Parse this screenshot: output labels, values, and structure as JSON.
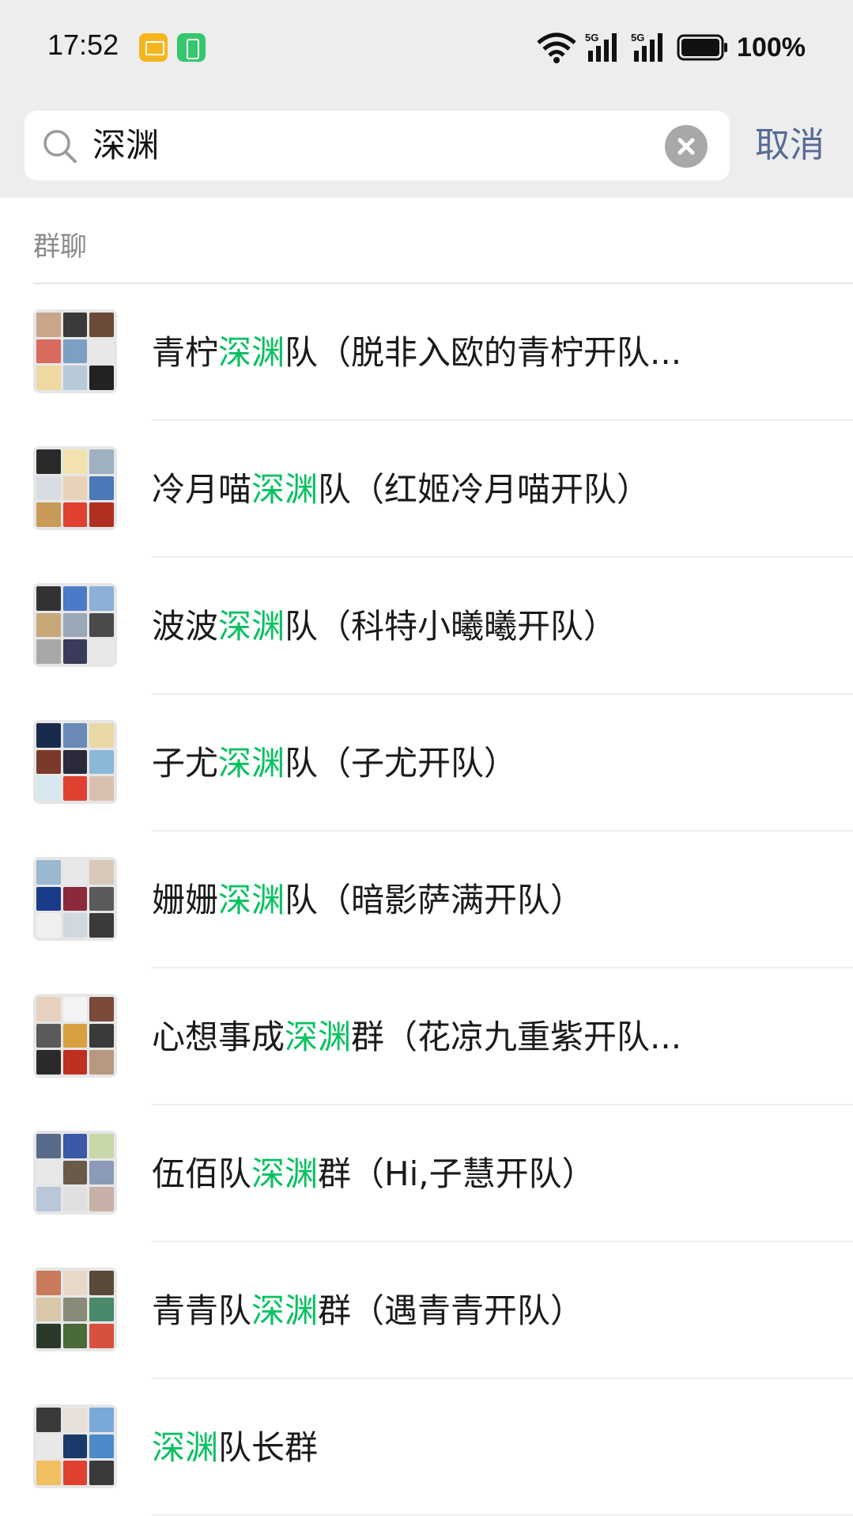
{
  "status_bar": {
    "time": "17:52",
    "battery_percent": "100%",
    "notification_icons": [
      "mail-icon",
      "battery-saver-icon"
    ],
    "system_icons": [
      "wifi-icon",
      "5g-signal-icon",
      "5g-signal-icon",
      "battery-icon"
    ],
    "network_label": "5G"
  },
  "search": {
    "query": "深渊",
    "cancel_label": "取消"
  },
  "section": {
    "title": "群聊"
  },
  "results": [
    {
      "pre": "青柠",
      "hl": "深渊",
      "post": "队（脱非入欧的青柠开队..."
    },
    {
      "pre": "冷月喵",
      "hl": "深渊",
      "post": "队（红姬冷月喵开队）"
    },
    {
      "pre": "波波",
      "hl": "深渊",
      "post": "队（科特小曦曦开队）"
    },
    {
      "pre": "子尤",
      "hl": "深渊",
      "post": "队（子尤开队）"
    },
    {
      "pre": "姗姗",
      "hl": "深渊",
      "post": "队（暗影萨满开队）"
    },
    {
      "pre": "心想事成",
      "hl": "深渊",
      "post": "群（花凉九重紫开队..."
    },
    {
      "pre": "伍佰队",
      "hl": "深渊",
      "post": "群（Hi,子慧开队）"
    },
    {
      "pre": "青青队",
      "hl": "深渊",
      "post": "群（遇青青开队）"
    },
    {
      "pre": "",
      "hl": "深渊",
      "post": "队长群"
    }
  ],
  "colors": {
    "highlight": "#07c160",
    "cancel": "#576b95",
    "top_bg": "#ededed"
  }
}
